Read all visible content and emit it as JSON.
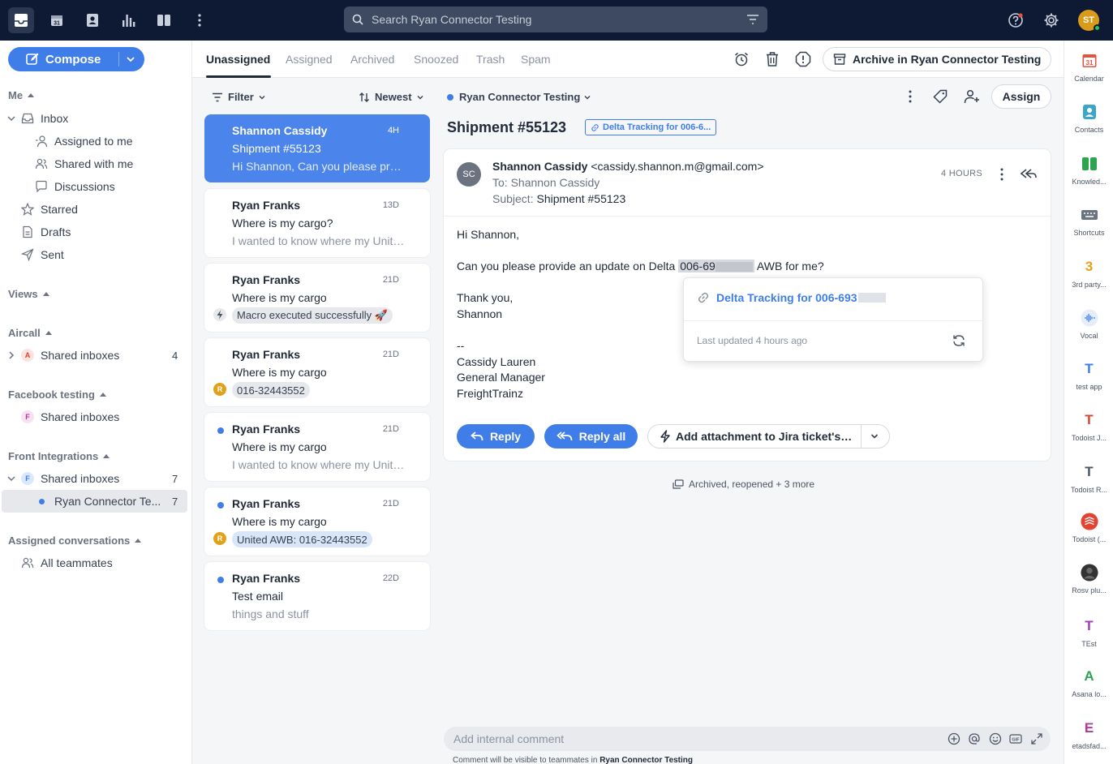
{
  "search": {
    "placeholder": "Search Ryan Connector Testing"
  },
  "user": {
    "initials": "ST"
  },
  "sidebar": {
    "compose_label": "Compose",
    "me": {
      "title": "Me",
      "inbox": "Inbox",
      "assigned_to_me": "Assigned to me",
      "shared_with_me": "Shared with me",
      "discussions": "Discussions",
      "starred": "Starred",
      "drafts": "Drafts",
      "sent": "Sent"
    },
    "views": {
      "title": "Views"
    },
    "aircall": {
      "title": "Aircall",
      "letter": "A",
      "item": "Shared inboxes",
      "count": "4"
    },
    "facebook": {
      "title": "Facebook testing",
      "letter": "F",
      "item": "Shared inboxes"
    },
    "front": {
      "title": "Front Integrations",
      "letter": "F",
      "item": "Shared inboxes",
      "count": "7",
      "sub_item": "Ryan Connector Te...",
      "sub_count": "7"
    },
    "assigned_convs": {
      "title": "Assigned conversations",
      "item": "All teammates"
    }
  },
  "tabs": [
    "Unassigned",
    "Assigned",
    "Archived",
    "Snoozed",
    "Trash",
    "Spam"
  ],
  "header": {
    "archive_label": "Archive in Ryan Connector Testing"
  },
  "list": {
    "filter_label": "Filter",
    "sort_label": "Newest",
    "items": [
      {
        "from": "Shannon Cassidy",
        "time": "4H",
        "subject": "Shipment #55123",
        "preview": "Hi Shannon, Can you please provide an update"
      },
      {
        "from": "Ryan Franks",
        "time": "13D",
        "subject": "Where is my cargo?",
        "preview": "I wanted to know where my United cargo is"
      },
      {
        "from": "Ryan Franks",
        "time": "21D",
        "subject": "Where is my cargo",
        "chip": "Macro executed successfully 🚀"
      },
      {
        "from": "Ryan Franks",
        "time": "21D",
        "subject": "Where is my cargo",
        "chip": "016-32443552",
        "lead": "R"
      },
      {
        "from": "Ryan Franks",
        "time": "21D",
        "subject": "Where is my cargo",
        "preview": "I wanted to know where my United cargo is"
      },
      {
        "from": "Ryan Franks",
        "time": "21D",
        "subject": "Where is my cargo",
        "chip": "United AWB: 016-32443552",
        "lead": "R"
      },
      {
        "from": "Ryan Franks",
        "time": "22D",
        "subject": "Test email",
        "preview": "things and stuff"
      }
    ]
  },
  "conversation": {
    "inbox_name": "Ryan Connector Testing",
    "assign_label": "Assign",
    "title": "Shipment #55123",
    "link_tag": "Delta Tracking for 006-6...",
    "email": {
      "avatar": "SC",
      "from_name": "Shannon Cassidy",
      "from_email": "<cassidy.shannon.m@gmail.com>",
      "to": "To: Shannon Cassidy",
      "subject_label": "Subject:",
      "subject_value": "Shipment #55123",
      "time": "4 HOURS",
      "body": {
        "greeting": "Hi Shannon,",
        "line_before": "Can you please provide an update on Delta",
        "awb_number": "006-69",
        "line_after": "AWB  for me?",
        "thanks": "Thank you,",
        "name": "Shannon",
        "dashes": "--",
        "sig_name": "Cassidy Lauren",
        "sig_title": "General Manager",
        "sig_company": "FreightTrainz"
      }
    },
    "popover": {
      "link_text": "Delta Tracking for 006-693",
      "updated": "Last updated 4 hours ago"
    },
    "reply_label": "Reply",
    "reply_all_label": "Reply all",
    "macro_label": "Add attachment to Jira ticket's description",
    "activity": "Archived, reopened + 3 more",
    "comment_placeholder": "Add internal comment",
    "comment_note_prefix": "Comment will be visible to teammates in",
    "comment_note_inbox": "Ryan Connector Testing"
  },
  "rail": [
    {
      "name": "Calendar",
      "glyph": "31",
      "color": "#e5533d"
    },
    {
      "name": "Contacts",
      "glyph": "",
      "color": "#3aa6c9"
    },
    {
      "name": "Knowled...",
      "glyph": "",
      "color": "#2ea44f"
    },
    {
      "name": "Shortcuts",
      "glyph": "",
      "color": "#6b7280"
    },
    {
      "name": "3rd party...",
      "glyph": "3",
      "color": "#e0a21b"
    },
    {
      "name": "Vocal",
      "glyph": "",
      "color": "#5b8def"
    },
    {
      "name": "test app",
      "glyph": "T",
      "color": "#3f7ee8"
    },
    {
      "name": "Todoist J...",
      "glyph": "T",
      "color": "#d9432f"
    },
    {
      "name": "Todoist R...",
      "glyph": "T",
      "color": "#4b5563"
    },
    {
      "name": "Todoist (...",
      "glyph": "",
      "color": "#e44332"
    },
    {
      "name": "Rosv plu...",
      "glyph": "",
      "color": "#333333"
    },
    {
      "name": "TEst",
      "glyph": "T",
      "color": "#9b3fb5"
    },
    {
      "name": "Asana lo...",
      "glyph": "A",
      "color": "#2ea44f"
    },
    {
      "name": "etadsfad...",
      "glyph": "E",
      "color": "#b0399d"
    }
  ]
}
